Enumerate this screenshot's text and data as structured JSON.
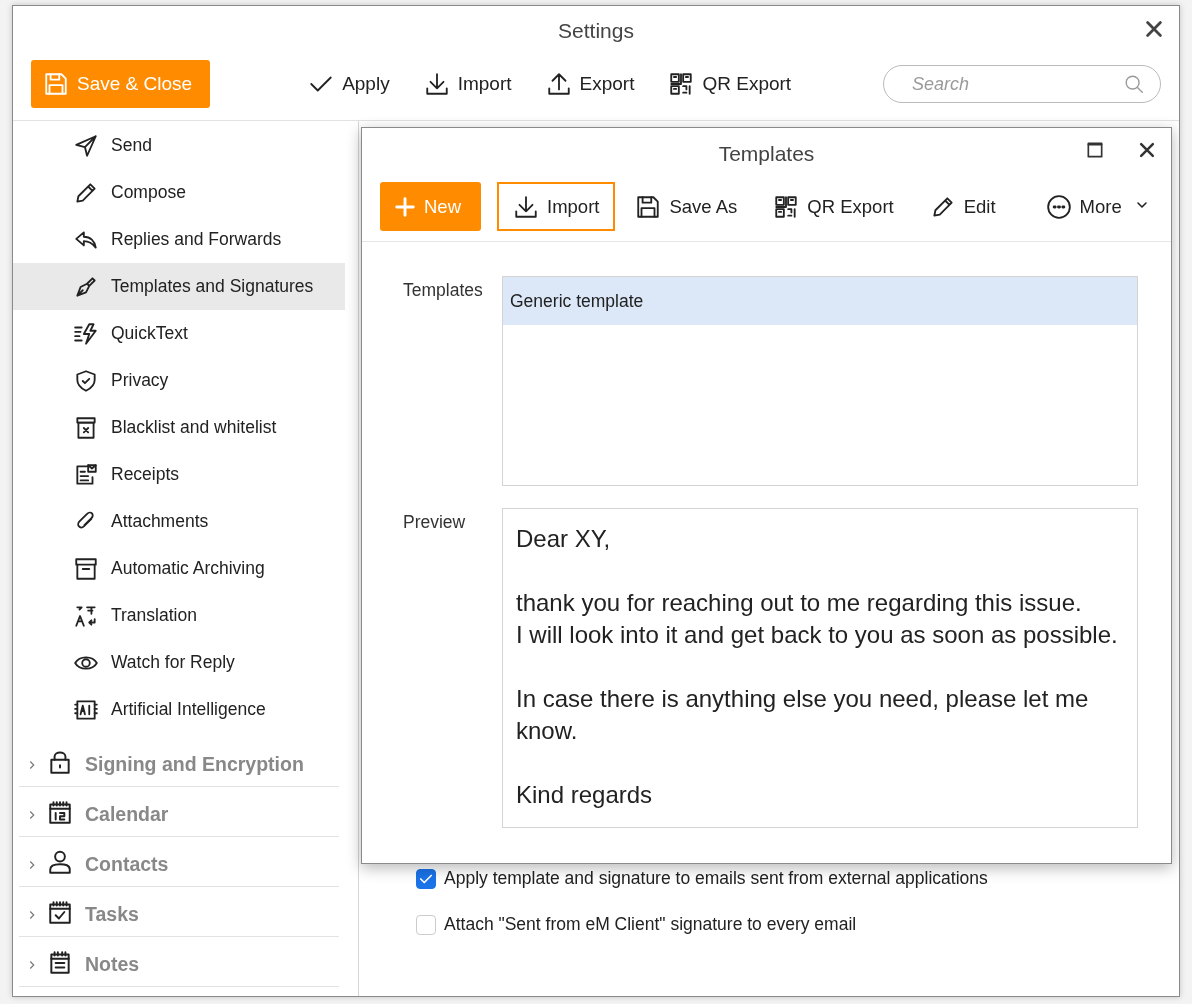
{
  "window": {
    "title": "Settings",
    "search": {
      "placeholder": "Search"
    }
  },
  "toolbar": [
    {
      "label": "Save & Close",
      "kind": "primary"
    },
    {
      "label": "Apply",
      "kind": "plain"
    },
    {
      "label": "Import",
      "kind": "plain"
    },
    {
      "label": "Export",
      "kind": "plain"
    },
    {
      "label": "QR Export",
      "kind": "plain"
    }
  ],
  "sidebar": {
    "items": [
      {
        "label": "Send",
        "selected": false
      },
      {
        "label": "Compose",
        "selected": false
      },
      {
        "label": "Replies and Forwards",
        "selected": false
      },
      {
        "label": "Templates and Signatures",
        "selected": true
      },
      {
        "label": "QuickText",
        "selected": false
      },
      {
        "label": "Privacy",
        "selected": false
      },
      {
        "label": "Blacklist and whitelist",
        "selected": false
      },
      {
        "label": "Receipts",
        "selected": false
      },
      {
        "label": "Attachments",
        "selected": false
      },
      {
        "label": "Automatic Archiving",
        "selected": false
      },
      {
        "label": "Translation",
        "selected": false
      },
      {
        "label": "Watch for Reply",
        "selected": false
      },
      {
        "label": "Artificial Intelligence",
        "selected": false
      }
    ],
    "groups": [
      {
        "label": "Signing and Encryption",
        "expanded": false
      },
      {
        "label": "Calendar",
        "expanded": false
      },
      {
        "label": "Contacts",
        "expanded": false
      },
      {
        "label": "Tasks",
        "expanded": false
      },
      {
        "label": "Notes",
        "expanded": false
      }
    ]
  },
  "dialog": {
    "title": "Templates",
    "toolbar": [
      {
        "label": "New",
        "kind": "primary",
        "focused": false
      },
      {
        "label": "Import",
        "kind": "plain",
        "focused": true
      },
      {
        "label": "Save As",
        "kind": "plain",
        "focused": false
      },
      {
        "label": "QR Export",
        "kind": "plain",
        "focused": false
      },
      {
        "label": "Edit",
        "kind": "plain",
        "focused": false
      },
      {
        "label": "More",
        "kind": "menu",
        "focused": false
      }
    ],
    "templates_label": "Templates",
    "templates": [
      {
        "name": "Generic template",
        "selected": true
      }
    ],
    "preview_label": "Preview",
    "preview": [
      [
        "Dear XY,"
      ],
      [
        "thank you for reaching out to me regarding this issue.",
        "I will look into it and get back to you as soon as possible."
      ],
      [
        "In case there is anything else you need, please let me know."
      ],
      [
        "Kind regards"
      ]
    ]
  },
  "options": [
    {
      "label": "Apply template and signature to emails sent from external applications",
      "checked": true
    },
    {
      "label": "Attach \"Sent from eM Client\" signature to every email",
      "checked": false
    }
  ]
}
